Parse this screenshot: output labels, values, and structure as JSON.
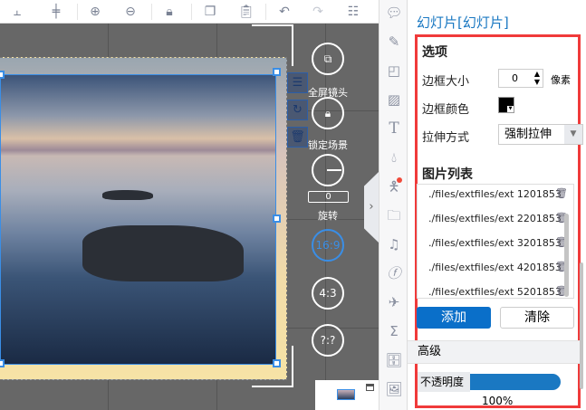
{
  "toolbar": {
    "items": [
      "align-bottom-icon",
      "align-center-icon",
      "zoom-in-icon",
      "zoom-out-icon",
      "lock-icon",
      "copy-icon",
      "paste-icon",
      "undo-icon",
      "redo-icon",
      "history-icon"
    ]
  },
  "canvas": {
    "side_buttons": [
      "layer-icon",
      "replace-image-icon",
      "delete-icon"
    ],
    "fullscreen_label": "全屏镜头",
    "lock_label": "锁定场景",
    "rotate_value": "0",
    "rotate_label": "旋转",
    "ratio_169": "16:9",
    "ratio_43": "4:3",
    "ratio_custom": "?:?"
  },
  "iconbar": [
    "comment-icon",
    "pen-icon",
    "shape-icon",
    "image-icon",
    "text-icon",
    "drop-icon",
    "person-icon",
    "folder-icon",
    "music-icon",
    "flash-icon",
    "plane-icon",
    "sigma-icon",
    "archive-icon",
    "add-image-icon"
  ],
  "panel": {
    "title": "幻灯片[幻灯片]",
    "options_heading": "选项",
    "border_size_label": "边框大小",
    "border_size_value": "0",
    "border_size_unit": "像素",
    "border_color_label": "边框颜色",
    "border_color": "#000000",
    "stretch_label": "拉伸方式",
    "stretch_value": "强制拉伸",
    "image_list_heading": "图片列表",
    "images": [
      "./files/extfiles/ext 1201853",
      "./files/extfiles/ext 2201853",
      "./files/extfiles/ext 3201853",
      "./files/extfiles/ext 4201853",
      "./files/extfiles/ext 5201853"
    ],
    "add_label": "添加",
    "clear_label": "清除",
    "advanced_label": "高级",
    "opacity_label": "不透明度",
    "opacity_value": "100%",
    "accent": "#0a6fc9"
  }
}
